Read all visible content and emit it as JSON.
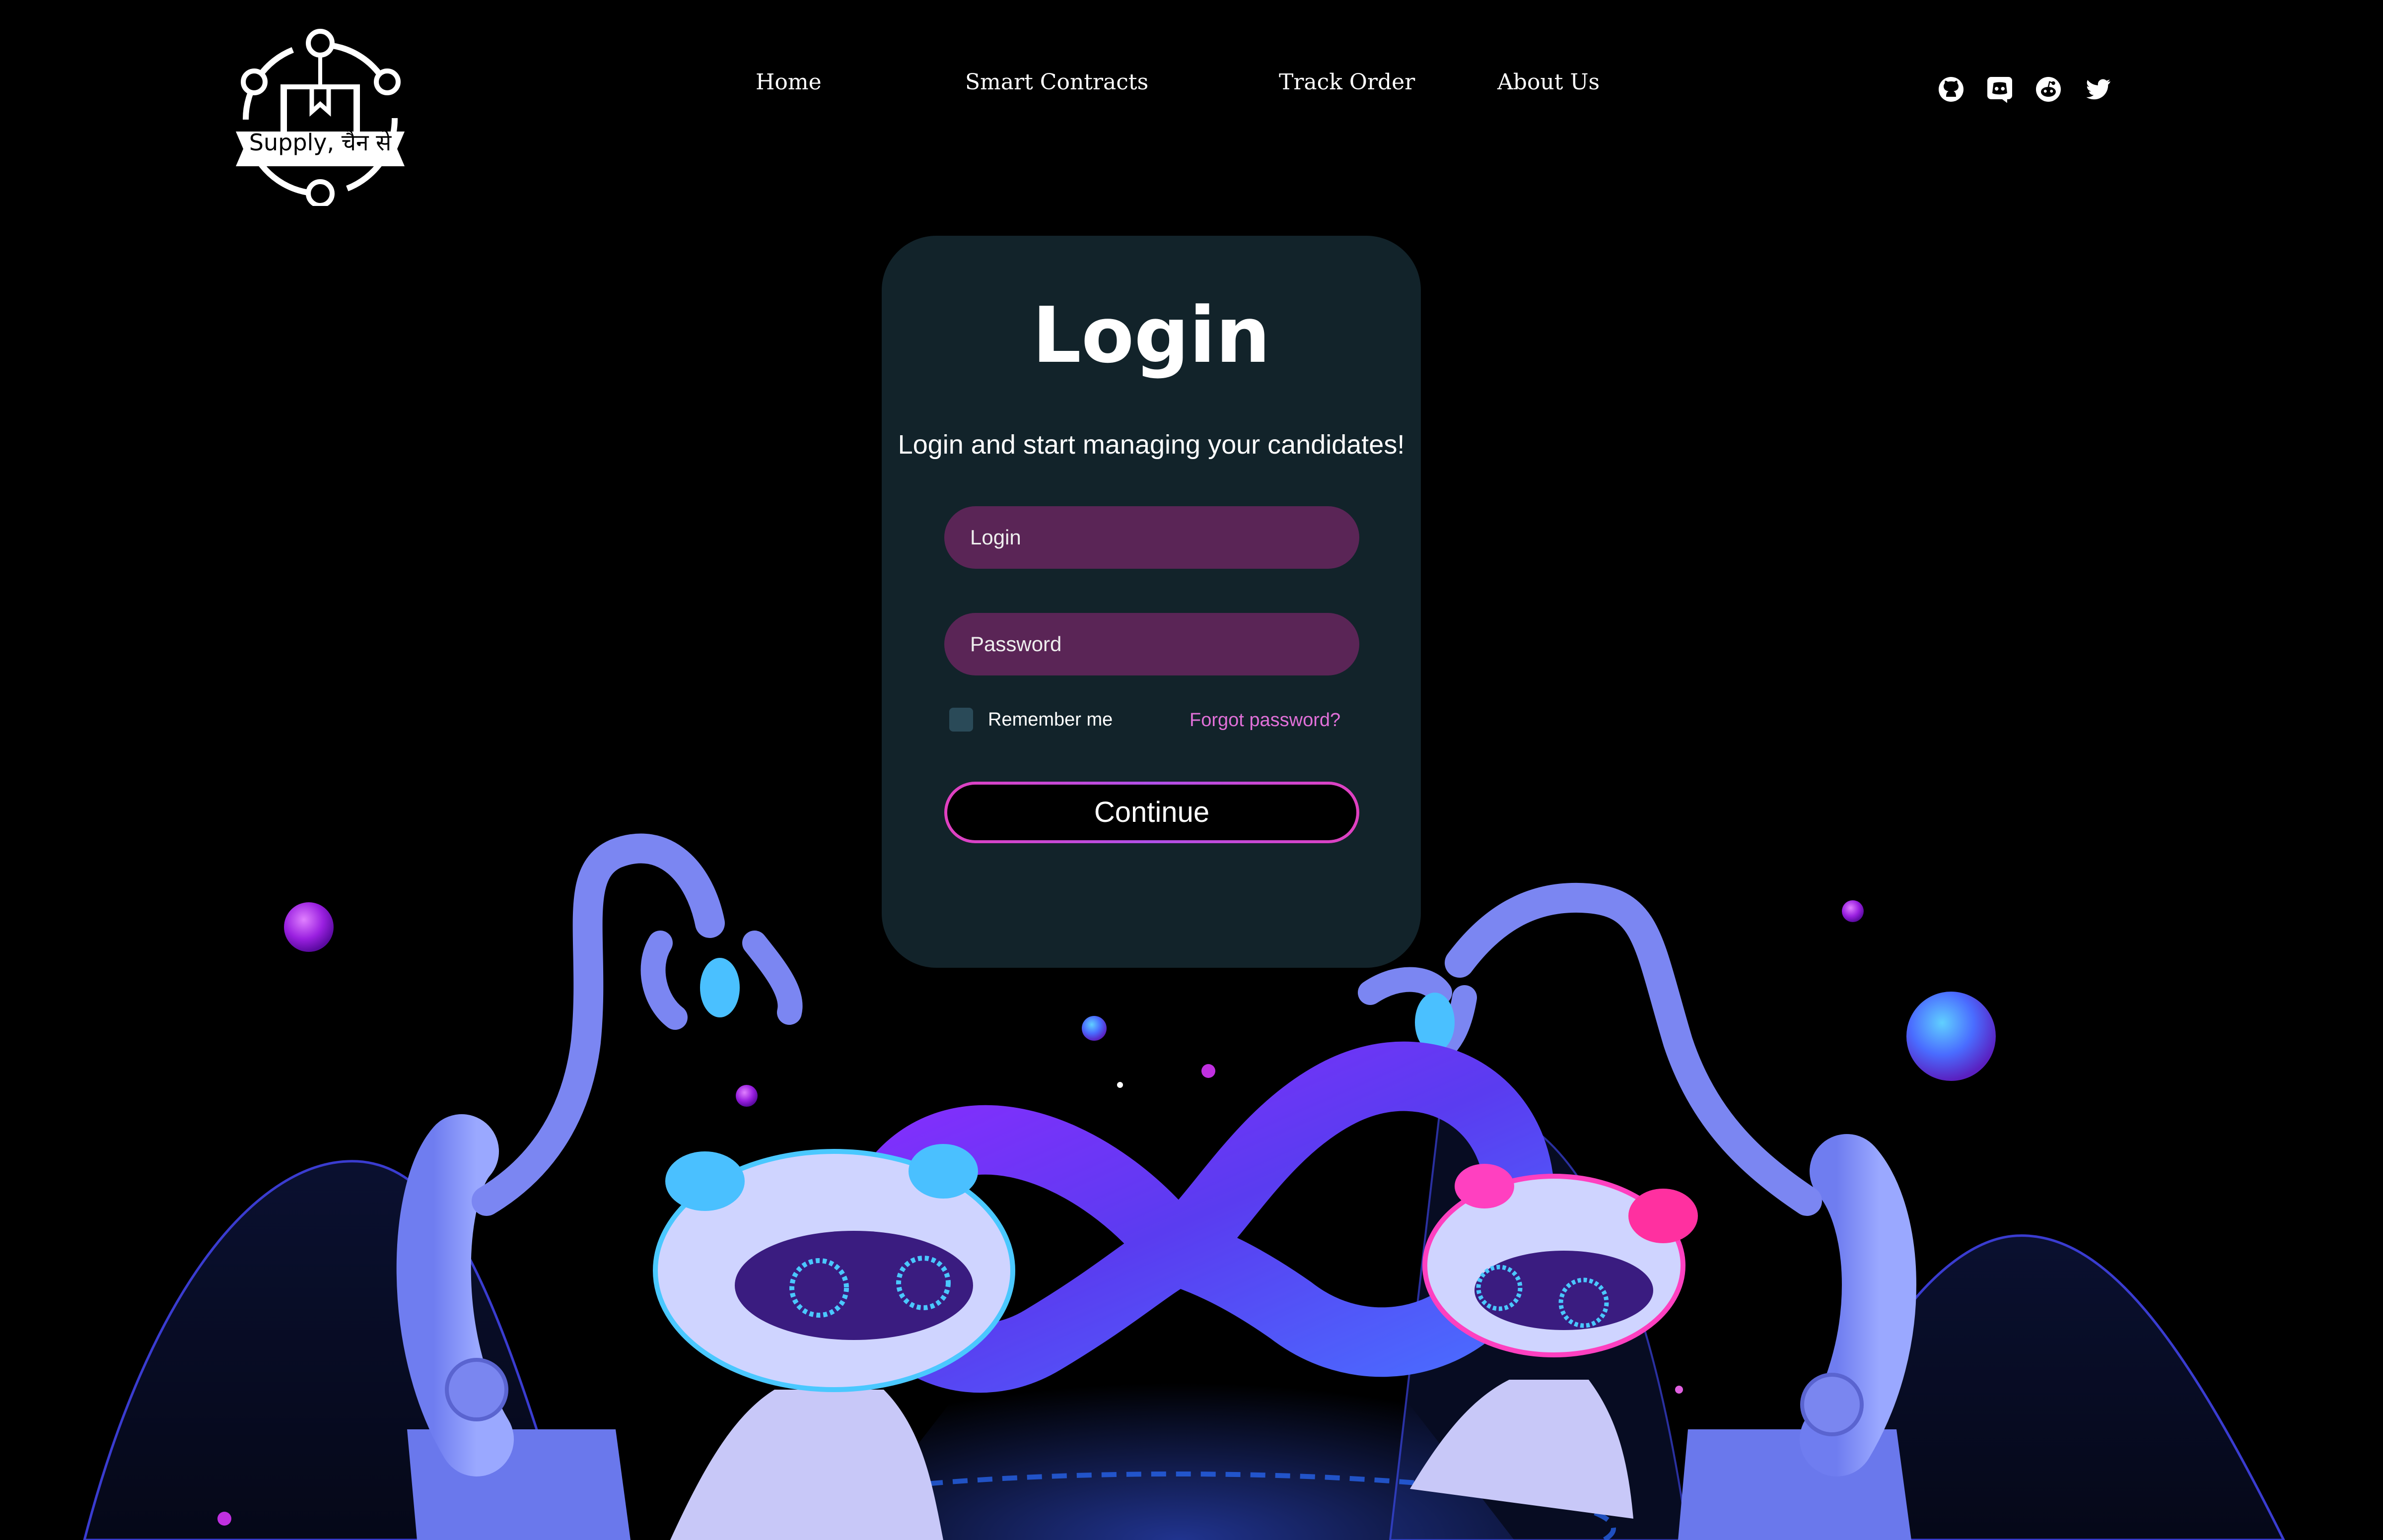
{
  "brand": {
    "logo_text": "Supply, चैन से"
  },
  "nav": {
    "items": [
      {
        "label": "Home"
      },
      {
        "label": "Smart Contracts"
      },
      {
        "label": "Track Order"
      },
      {
        "label": "About Us"
      }
    ]
  },
  "social": [
    {
      "icon": "github-icon"
    },
    {
      "icon": "discord-icon"
    },
    {
      "icon": "reddit-icon"
    },
    {
      "icon": "twitter-icon"
    }
  ],
  "login": {
    "title": "Login",
    "subtitle": "Login and start managing your candidates!",
    "login_placeholder": "Login",
    "password_placeholder": "Password",
    "remember_label": "Remember me",
    "forgot_label": "Forgot password?",
    "continue_label": "Continue"
  },
  "colors": {
    "background": "#000000",
    "card": "#12232a",
    "field": "#5a2556",
    "accent_pink": "#e070d8",
    "accent_purple": "#7b3cff"
  }
}
